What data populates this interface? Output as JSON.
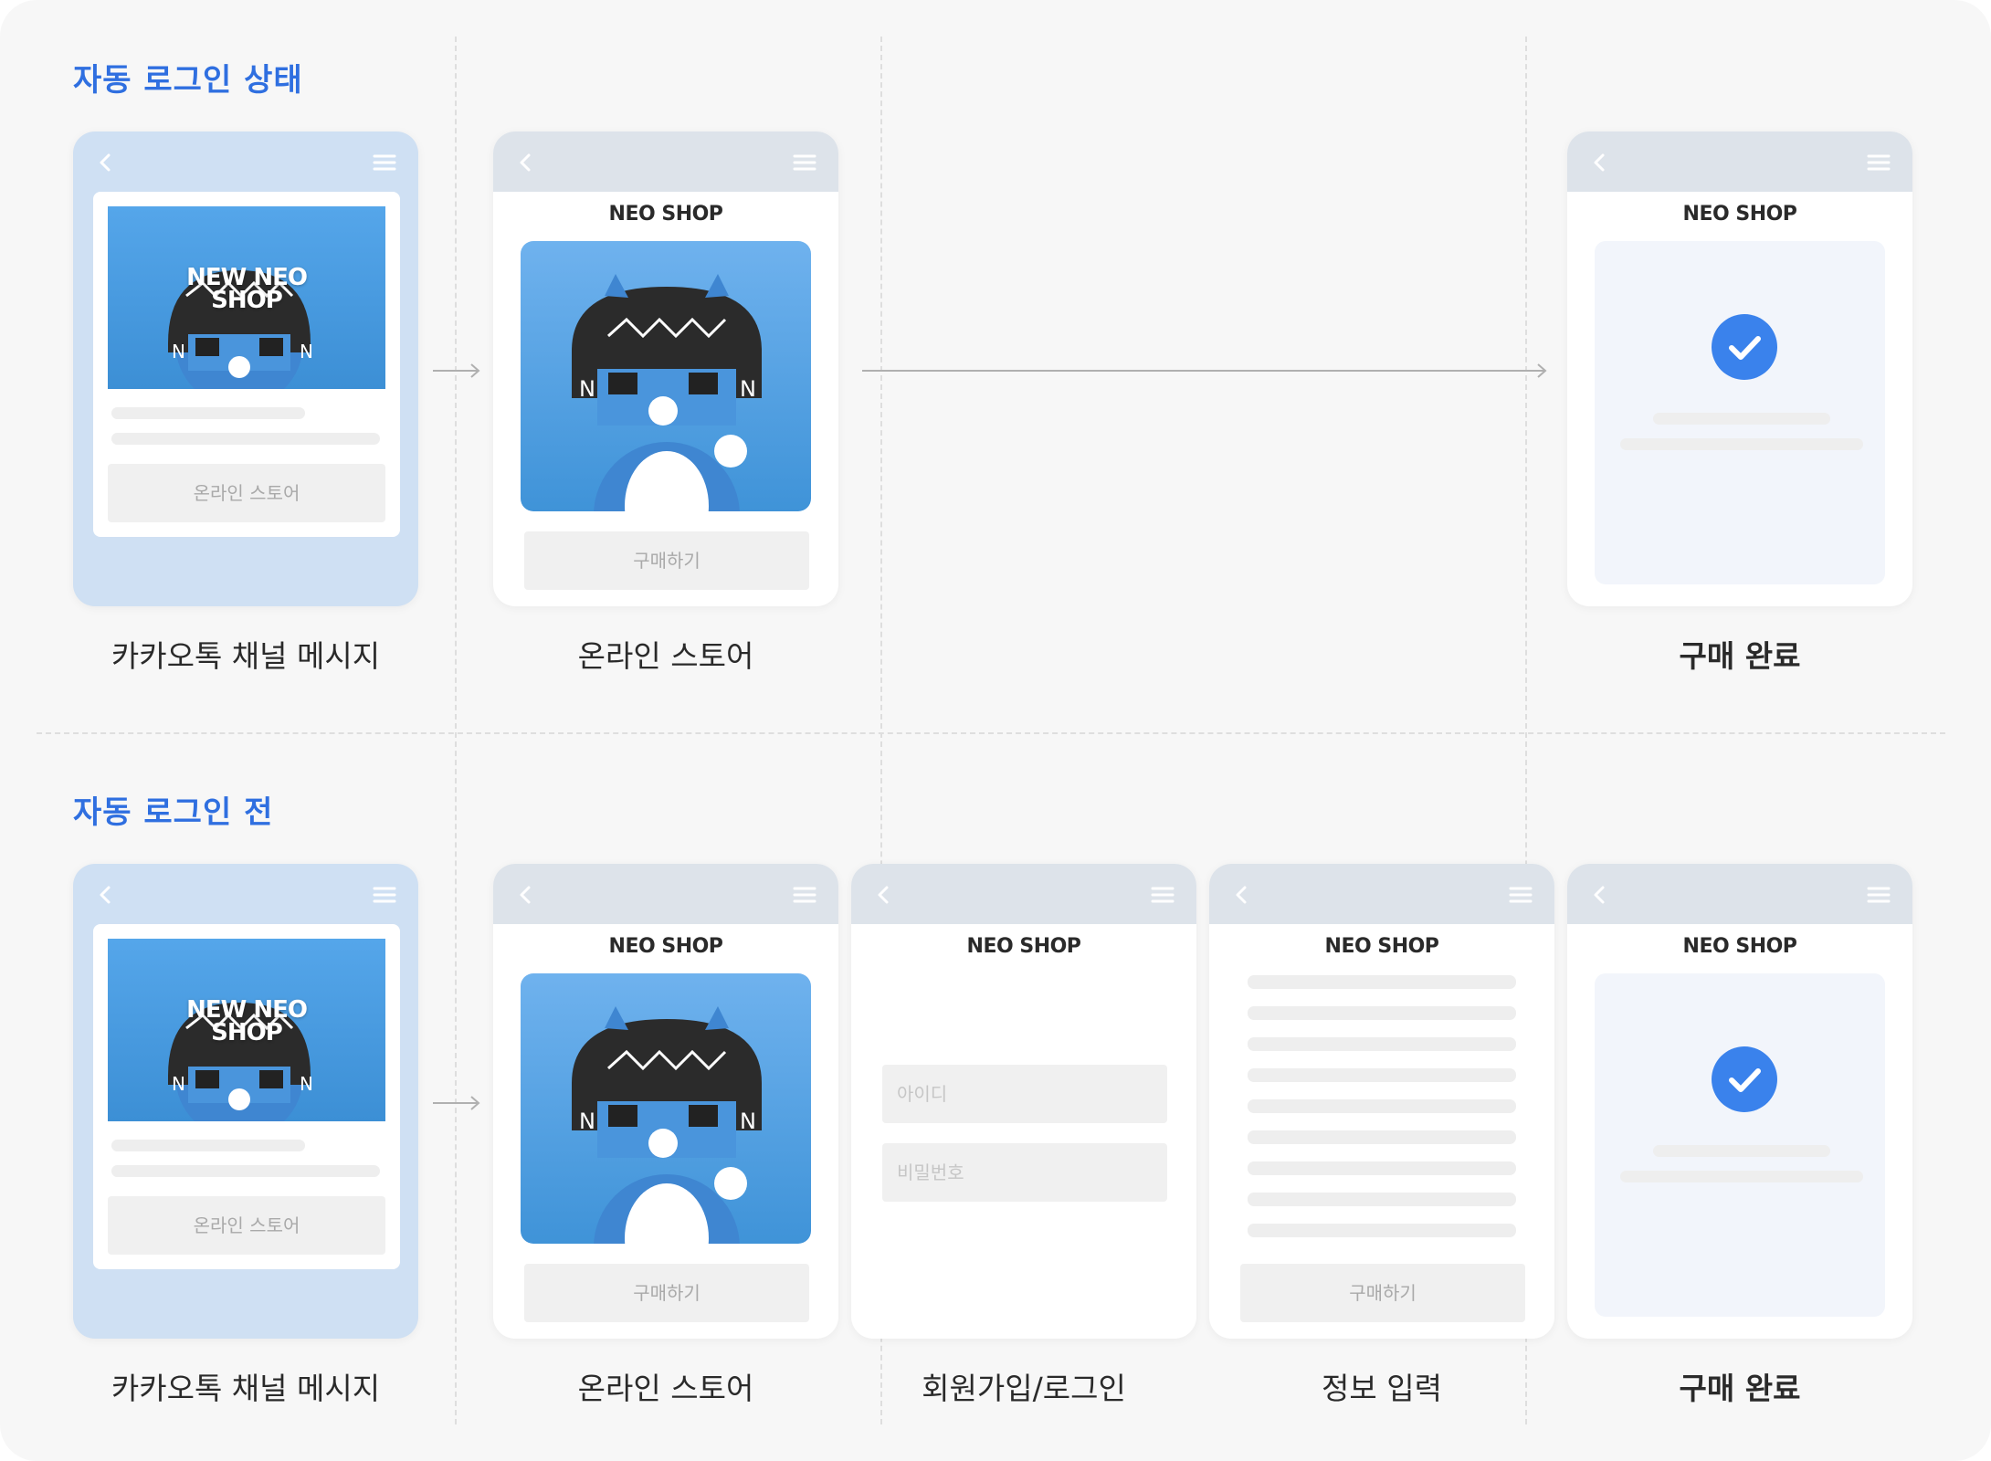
{
  "rows": {
    "top": {
      "title": "자동 로그인 상태",
      "captions": [
        "카카오톡 채널 메시지",
        "온라인 스토어",
        "구매 완료"
      ]
    },
    "bottom": {
      "title": "자동 로그인 전",
      "captions": [
        "카카오톡 채널 메시지",
        "온라인 스토어",
        "회원가입/로그인",
        "정보 입력",
        "구매 완료"
      ]
    }
  },
  "screens": {
    "shop_name": "NEO SHOP",
    "kakao_banner": "NEW NEO SHOP",
    "kakao_banner_line1": "NEW NEO",
    "kakao_banner_line2": "SHOP",
    "kakao_button": "온라인 스토어",
    "buy_button": "구매하기",
    "id_placeholder": "아이디",
    "password_placeholder": "비밀번호"
  },
  "colors": {
    "accent": "#2f6fe0",
    "check": "#3a82ec",
    "kakao_screen_bg": "#cfe0f3",
    "phone_bar": "#dde3ea",
    "canvas": "#f7f7f7"
  },
  "icons": [
    "back-chevron-icon",
    "hamburger-menu-icon",
    "check-circle-icon",
    "arrow-right-icon"
  ]
}
